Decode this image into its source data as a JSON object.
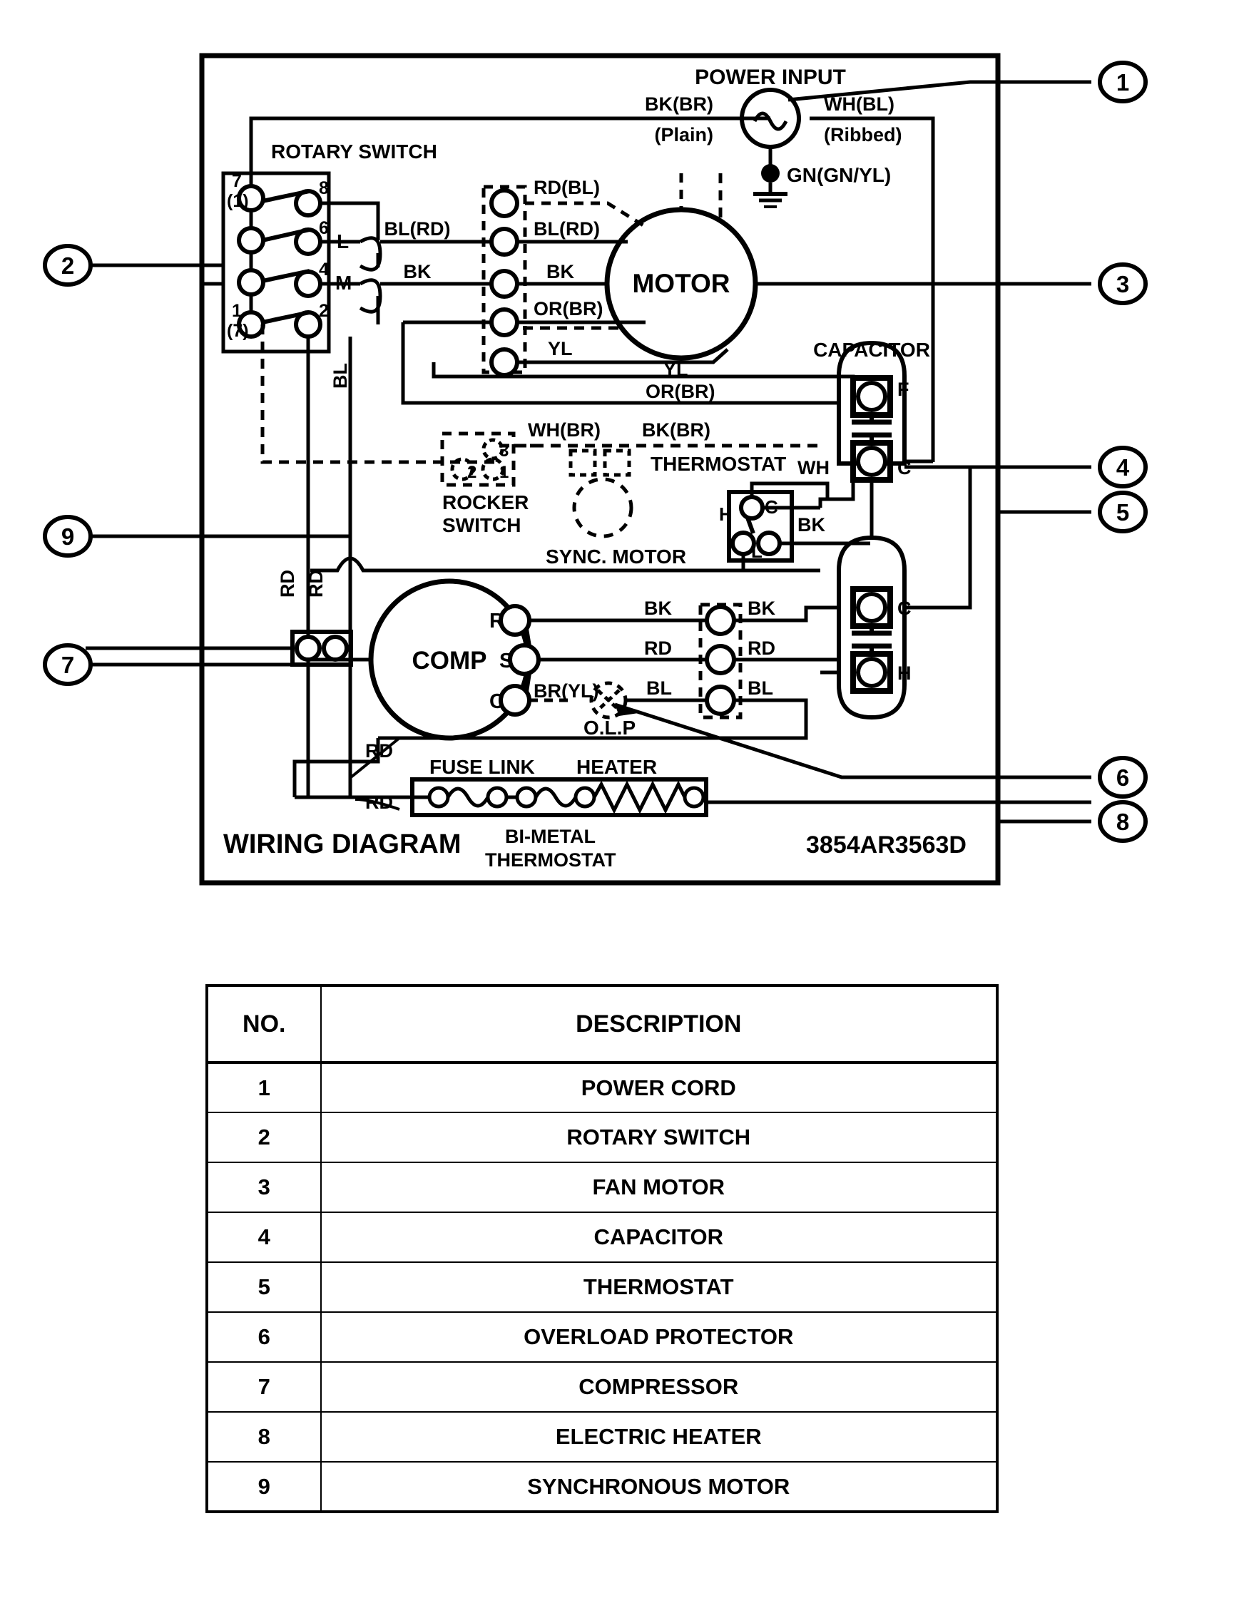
{
  "diagram": {
    "title": "WIRING DIAGRAM",
    "part_number": "3854AR3563D",
    "power_input": {
      "label": "POWER INPUT",
      "line_left": "BK(BR)",
      "line_left_sub": "(Plain)",
      "line_right": "WH(BL)",
      "line_right_sub": "(Ribbed)",
      "ground": "GN(GN/YL)"
    },
    "rotary_switch": {
      "label": "ROTARY SWITCH",
      "terminals": [
        "7",
        "(1)",
        "8",
        "6",
        "4",
        "1",
        "(7)",
        "2"
      ],
      "taps": [
        "L",
        "M"
      ],
      "wire_bl": "BL"
    },
    "motor": {
      "label": "MOTOR",
      "leads_left": [
        "BL(RD)",
        "BK"
      ],
      "leads_block": [
        "RD(BL)",
        "BL(RD)",
        "BK",
        "OR(BR)",
        "YL"
      ],
      "lead_yl": "YL",
      "lead_or": "OR(BR)"
    },
    "capacitor": {
      "label": "CAPACITOR",
      "terminal_f": "F",
      "terminal_c": "C",
      "terminal_c2": "C",
      "terminal_h": "H"
    },
    "thermostat": {
      "label": "THERMOSTAT",
      "wire_wh_br": "WH(BR)",
      "wire_bk_br": "BK(BR)",
      "wire_wh": "WH",
      "wire_bk": "BK",
      "terminal_h": "H",
      "terminal_c": "C",
      "terminal_l": "L"
    },
    "rocker_switch": {
      "label_line1": "ROCKER",
      "label_line2": "SWITCH",
      "pins": [
        "1",
        "2",
        "3"
      ]
    },
    "sync_motor": {
      "label": "SYNC. MOTOR"
    },
    "compressor": {
      "label": "COMP",
      "terminals": [
        "R",
        "S",
        "C"
      ],
      "lead_br_yl": "BR(YL)",
      "olp": "O.L.P",
      "leads_left": [
        "BK",
        "RD",
        "BL"
      ],
      "leads_right": [
        "BK",
        "RD",
        "BL"
      ],
      "wire_rd_1": "RD",
      "wire_rd_2": "RD",
      "wire_rd_3": "RD",
      "wire_rd_4": "RD"
    },
    "heater": {
      "fuse_link": "FUSE LINK",
      "heater": "HEATER",
      "bimetal_line1": "BI-METAL",
      "bimetal_line2": "THERMOSTAT"
    },
    "callouts_left": [
      "2",
      "9",
      "7"
    ],
    "callouts_right": [
      "1",
      "3",
      "4",
      "5",
      "6",
      "8"
    ]
  },
  "parts_table": {
    "headers": [
      "NO.",
      "DESCRIPTION"
    ],
    "rows": [
      {
        "no": "1",
        "desc": "POWER CORD"
      },
      {
        "no": "2",
        "desc": "ROTARY SWITCH"
      },
      {
        "no": "3",
        "desc": "FAN MOTOR"
      },
      {
        "no": "4",
        "desc": "CAPACITOR"
      },
      {
        "no": "5",
        "desc": "THERMOSTAT"
      },
      {
        "no": "6",
        "desc": "OVERLOAD PROTECTOR"
      },
      {
        "no": "7",
        "desc": "COMPRESSOR"
      },
      {
        "no": "8",
        "desc": "ELECTRIC HEATER"
      },
      {
        "no": "9",
        "desc": "SYNCHRONOUS MOTOR"
      }
    ]
  },
  "colors": {
    "ink": "#000000",
    "paper": "#ffffff"
  }
}
